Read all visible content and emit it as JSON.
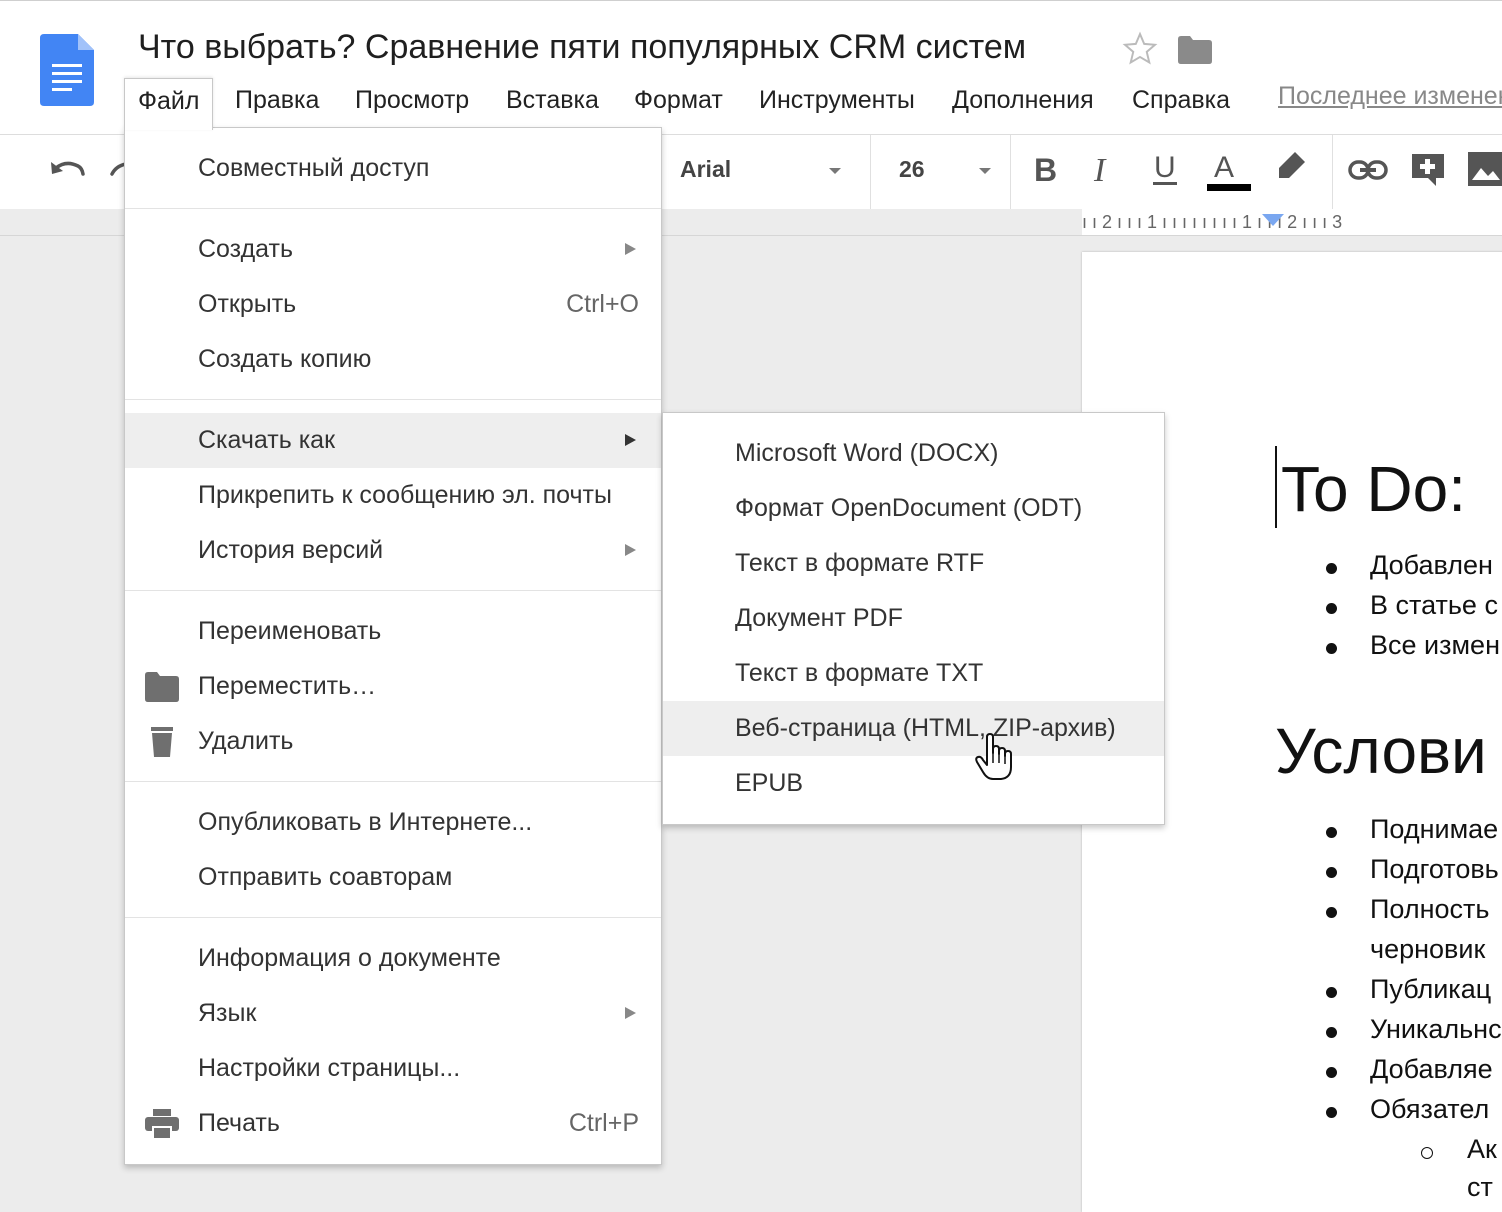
{
  "document": {
    "title": "Что выбрать? Сравнение пяти популярных CRM систем",
    "last_edit": "Последнее изменение"
  },
  "menubar": {
    "items": [
      {
        "label": "Файл"
      },
      {
        "label": "Правка"
      },
      {
        "label": "Просмотр"
      },
      {
        "label": "Вставка"
      },
      {
        "label": "Формат"
      },
      {
        "label": "Инструменты"
      },
      {
        "label": "Дополнения"
      },
      {
        "label": "Справка"
      }
    ]
  },
  "toolbar": {
    "font": "Arial",
    "font_size": "26",
    "text_color": "#000000",
    "icons": [
      "undo-icon",
      "redo-icon",
      "bold-icon",
      "italic-icon",
      "underline-icon",
      "text-color-icon",
      "highlight-icon",
      "link-icon",
      "comment-icon",
      "image-icon"
    ]
  },
  "ruler": {
    "text": "ı ı 2 ı ı ı 1 ı ı ı ı ı ı ı ı 1 ı ı ı 2 ı ı ı 3"
  },
  "file_menu": {
    "share": "Совместный доступ",
    "new": "Создать",
    "open": "Открыть",
    "open_shortcut": "Ctrl+O",
    "make_copy": "Создать копию",
    "download_as": "Скачать как",
    "email_attach": "Прикрепить к сообщению эл. почты",
    "version_history": "История версий",
    "rename": "Переименовать",
    "move": "Переместить…",
    "delete": "Удалить",
    "publish": "Опубликовать в Интернете...",
    "email_collaborators": "Отправить соавторам",
    "doc_details": "Информация о документе",
    "language": "Язык",
    "page_setup": "Настройки страницы...",
    "print": "Печать",
    "print_shortcut": "Ctrl+P"
  },
  "download_submenu": {
    "items": [
      {
        "label": "Microsoft Word (DOCX)"
      },
      {
        "label": "Формат OpenDocument (ODT)"
      },
      {
        "label": "Текст в формате RTF"
      },
      {
        "label": "Документ PDF"
      },
      {
        "label": "Текст в формате TXT"
      },
      {
        "label": "Веб-страница (HTML, ZIP-архив)"
      },
      {
        "label": "EPUB"
      }
    ],
    "highlighted": "Веб-страница (HTML, ZIP-архив)"
  },
  "page_content": {
    "heading1": "To Do:",
    "bullets1": [
      "Добавлен",
      "В статье с",
      "Все измен"
    ],
    "heading2": "Услови",
    "bullets2": [
      "Поднимае",
      "Подготовь",
      "Полность",
      "черновик",
      "Публикац",
      "Уникальнс",
      "Добавляе",
      "Обязател"
    ],
    "sub_bullet": "Ак",
    "sub_bullet_cont": "ст"
  },
  "colors": {
    "doc_icon_blue": "#4285f4",
    "ruler_marker": "#7aa7f0",
    "menu_highlight": "#eeeeee"
  }
}
